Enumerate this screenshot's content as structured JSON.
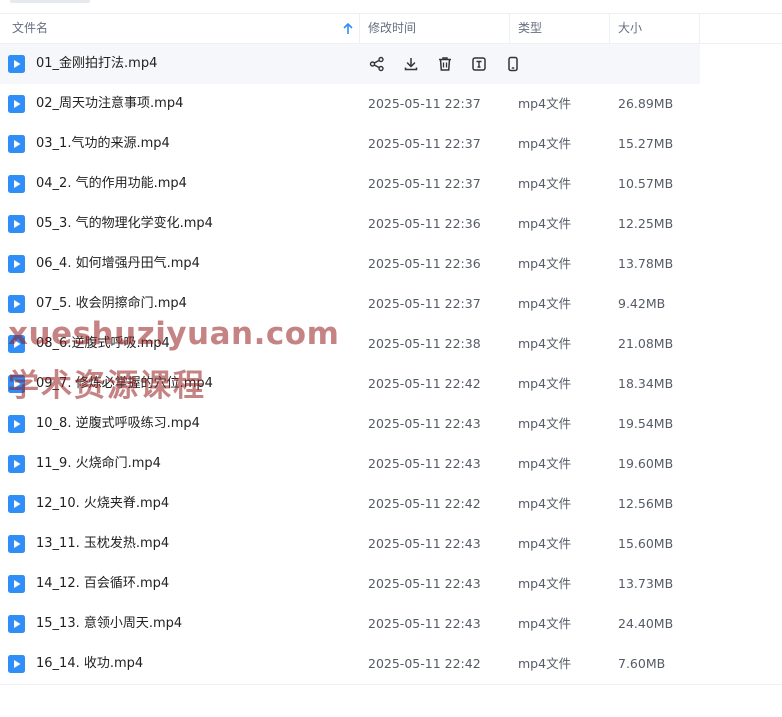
{
  "columns": {
    "name": "文件名",
    "time": "修改时间",
    "type": "类型",
    "size": "大小"
  },
  "colors": {
    "file_icon": "#2f8ef8",
    "watermark": "#961e1e"
  },
  "hover_actions": [
    "share-icon",
    "download-icon",
    "delete-icon",
    "rename-icon",
    "phone-icon"
  ],
  "files": [
    {
      "name": "01_金刚拍打法.mp4",
      "time": "",
      "type": "",
      "size": ""
    },
    {
      "name": "02_周天功注意事项.mp4",
      "time": "2025-05-11 22:37",
      "type": "mp4文件",
      "size": "26.89MB"
    },
    {
      "name": "03_1.气功的来源.mp4",
      "time": "2025-05-11 22:37",
      "type": "mp4文件",
      "size": "15.27MB"
    },
    {
      "name": "04_2. 气的作用功能.mp4",
      "time": "2025-05-11 22:37",
      "type": "mp4文件",
      "size": "10.57MB"
    },
    {
      "name": "05_3. 气的物理化学变化.mp4",
      "time": "2025-05-11 22:36",
      "type": "mp4文件",
      "size": "12.25MB"
    },
    {
      "name": "06_4. 如何增强丹田气.mp4",
      "time": "2025-05-11 22:36",
      "type": "mp4文件",
      "size": "13.78MB"
    },
    {
      "name": "07_5. 收会阴擦命门.mp4",
      "time": "2025-05-11 22:37",
      "type": "mp4文件",
      "size": "9.42MB"
    },
    {
      "name": "08_6.逆腹式呼吸.mp4",
      "time": "2025-05-11 22:38",
      "type": "mp4文件",
      "size": "21.08MB"
    },
    {
      "name": "09_7. 修炼必掌握的穴位.mp4",
      "time": "2025-05-11 22:42",
      "type": "mp4文件",
      "size": "18.34MB"
    },
    {
      "name": "10_8. 逆腹式呼吸练习.mp4",
      "time": "2025-05-11 22:43",
      "type": "mp4文件",
      "size": "19.54MB"
    },
    {
      "name": "11_9. 火烧命门.mp4",
      "time": "2025-05-11 22:43",
      "type": "mp4文件",
      "size": "19.60MB"
    },
    {
      "name": "12_10. 火烧夹脊.mp4",
      "time": "2025-05-11 22:42",
      "type": "mp4文件",
      "size": "12.56MB"
    },
    {
      "name": "13_11. 玉枕发热.mp4",
      "time": "2025-05-11 22:43",
      "type": "mp4文件",
      "size": "15.60MB"
    },
    {
      "name": "14_12. 百会循环.mp4",
      "time": "2025-05-11 22:43",
      "type": "mp4文件",
      "size": "13.73MB"
    },
    {
      "name": "15_13. 意领小周天.mp4",
      "time": "2025-05-11 22:43",
      "type": "mp4文件",
      "size": "24.40MB"
    },
    {
      "name": "16_14. 收功.mp4",
      "time": "2025-05-11 22:42",
      "type": "mp4文件",
      "size": "7.60MB"
    }
  ],
  "watermark": {
    "line1": "xueshuziyuan.com",
    "line2": "学术资源课程"
  }
}
